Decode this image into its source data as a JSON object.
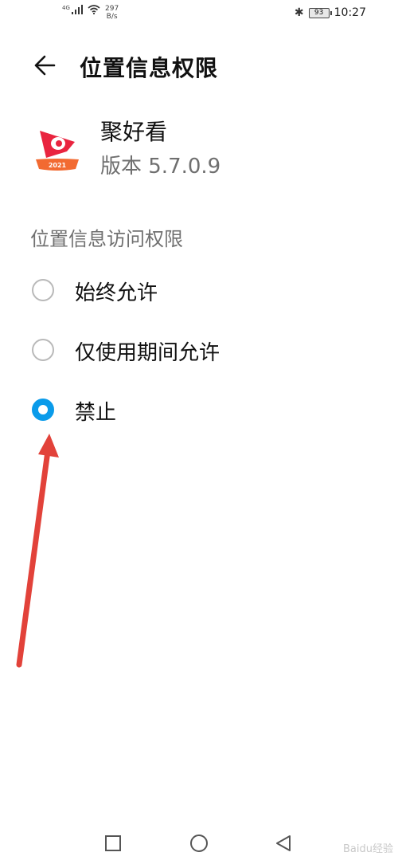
{
  "status_bar": {
    "network": "4G",
    "speed_value": "297",
    "speed_unit": "B/s",
    "battery": "93",
    "time": "10:27"
  },
  "header": {
    "title": "位置信息权限",
    "back_icon": "arrow-left-icon"
  },
  "app": {
    "name": "聚好看",
    "version": "版本 5.7.0.9",
    "icon_badge": "2021",
    "icon": "jhk-app-icon",
    "colors": {
      "primary": "#e9243f",
      "badge": "#f26a31"
    }
  },
  "section": {
    "label": "位置信息访问权限"
  },
  "options": [
    {
      "label": "始终允许",
      "checked": false
    },
    {
      "label": "仅使用期间允许",
      "checked": false
    },
    {
      "label": "禁止",
      "checked": true
    }
  ],
  "colors": {
    "accent": "#0a9bea",
    "annotation_arrow": "#e2423a"
  },
  "watermark": "Baidu经验",
  "nav": {
    "icons": [
      "square-icon",
      "circle-icon",
      "triangle-back-icon"
    ]
  }
}
